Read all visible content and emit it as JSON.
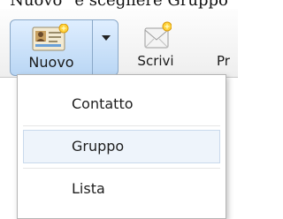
{
  "caption": "Nuovo\" e scegliere Gruppo",
  "toolbar": {
    "nuovo_label": "Nuovo",
    "scrivi_label": "Scrivi",
    "third_label": "Pr"
  },
  "menu": {
    "items": [
      {
        "label": "Contatto"
      },
      {
        "label": "Gruppo",
        "selected": true
      },
      {
        "label": "Lista"
      }
    ]
  },
  "colors": {
    "button_highlight": "#b9d6f4",
    "menu_selected": "#eef4fb"
  }
}
